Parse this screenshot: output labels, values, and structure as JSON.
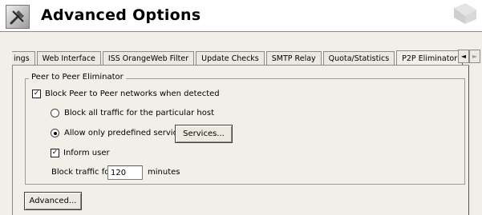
{
  "header": {
    "title": "Advanced Options"
  },
  "tabs": [
    {
      "label": "ings",
      "selected": false
    },
    {
      "label": "Web Interface",
      "selected": false
    },
    {
      "label": "ISS OrangeWeb Filter",
      "selected": false
    },
    {
      "label": "Update Checks",
      "selected": false
    },
    {
      "label": "SMTP Relay",
      "selected": false
    },
    {
      "label": "Quota/Statistics",
      "selected": false
    },
    {
      "label": "P2P Eliminator",
      "selected": true
    }
  ],
  "tab_scroll": {
    "left_symbol": "◄",
    "right_symbol": "►"
  },
  "group": {
    "legend": "Peer to Peer Eliminator",
    "block_p2p": {
      "label": "Block Peer to Peer networks when detected",
      "checked": true
    },
    "block_all": {
      "label": "Block all traffic for the particular host",
      "selected": false
    },
    "allow_predefined": {
      "label": "Allow only predefined services",
      "selected": true
    },
    "services_button": "Services...",
    "inform_user": {
      "label": "Inform user",
      "checked": true
    },
    "block_traffic_prefix": "Block traffic for",
    "block_traffic_value": "120",
    "block_traffic_suffix": "minutes"
  },
  "advanced_button": "Advanced..."
}
